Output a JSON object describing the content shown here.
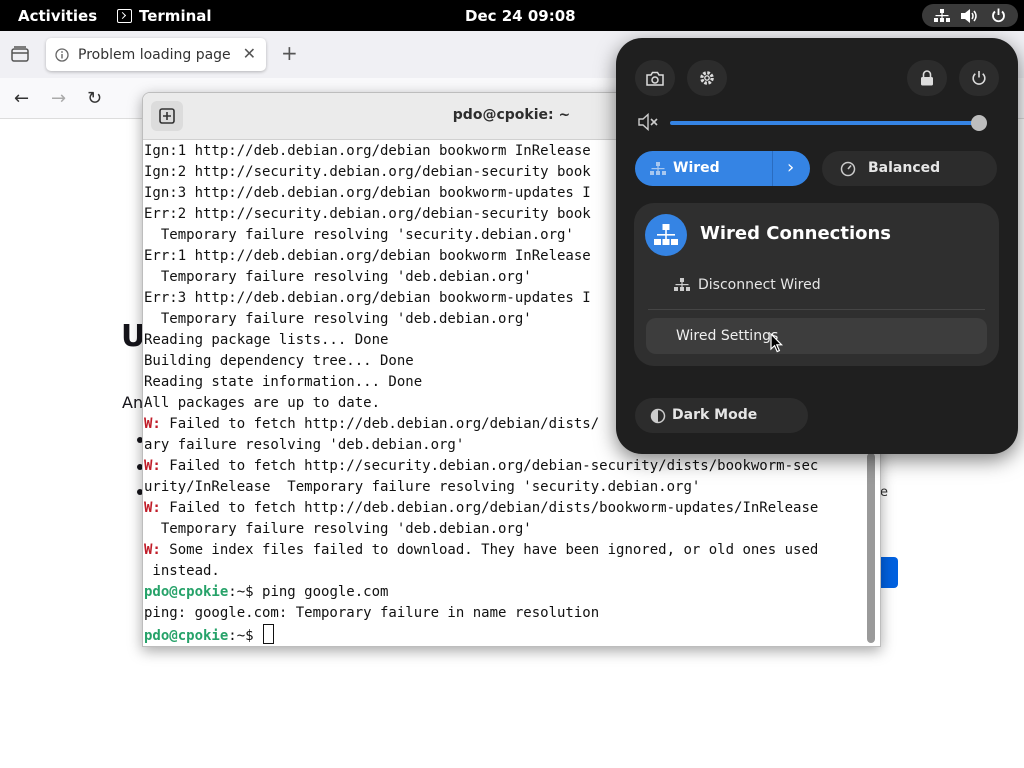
{
  "topbar": {
    "activities": "Activities",
    "app_name": "Terminal",
    "clock": "Dec 24  09:08",
    "status_icons": [
      "network-wired-icon",
      "volume-icon",
      "power-icon"
    ]
  },
  "browser": {
    "tab_title": "Problem loading page",
    "tab_close": "✕",
    "new_tab": "+",
    "nav": {
      "back": "←",
      "forward": "→",
      "reload": "↻"
    },
    "page_heading_fragment": "U",
    "page_text_fragment": "An",
    "page_right_fragment": "e"
  },
  "terminal": {
    "title": "pdo@cpokie: ~",
    "lines": [
      {
        "t": "Ign:1 http://deb.debian.org/debian bookworm InRelease"
      },
      {
        "t": "Ign:2 http://security.debian.org/debian-security book"
      },
      {
        "t": "Ign:3 http://deb.debian.org/debian bookworm-updates I"
      },
      {
        "t": "Err:2 http://security.debian.org/debian-security book"
      },
      {
        "t": "  Temporary failure resolving 'security.debian.org'"
      },
      {
        "t": "Err:1 http://deb.debian.org/debian bookworm InRelease"
      },
      {
        "t": "  Temporary failure resolving 'deb.debian.org'"
      },
      {
        "t": "Err:3 http://deb.debian.org/debian bookworm-updates I"
      },
      {
        "t": "  Temporary failure resolving 'deb.debian.org'"
      },
      {
        "t": "Reading package lists... Done"
      },
      {
        "t": "Building dependency tree... Done"
      },
      {
        "t": "Reading state information... Done"
      },
      {
        "t": "All packages are up to date."
      },
      {
        "w": "W:",
        "t": " Failed to fetch http://deb.debian.org/debian/dists/"
      },
      {
        "t": "ary failure resolving 'deb.debian.org'"
      },
      {
        "w": "W:",
        "t": " Failed to fetch http://security.debian.org/debian-security/dists/bookworm-sec"
      },
      {
        "t": "urity/InRelease  Temporary failure resolving 'security.debian.org'"
      },
      {
        "w": "W:",
        "t": " Failed to fetch http://deb.debian.org/debian/dists/bookworm-updates/InRelease"
      },
      {
        "t": "  Temporary failure resolving 'deb.debian.org'"
      },
      {
        "w": "W:",
        "t": " Some index files failed to download. They have been ignored, or old ones used"
      },
      {
        "t": " instead."
      },
      {
        "p": "pdo@cpokie",
        "t": ":~$ ping google.com"
      },
      {
        "t": "ping: google.com: Temporary failure in name resolution"
      },
      {
        "p": "pdo@cpokie",
        "t": ":~$ ",
        "cursor": true
      }
    ]
  },
  "quick_settings": {
    "volume_level": 0.98,
    "wired_label": "Wired",
    "wired_arrow": "›",
    "power_profile_label": "Balanced",
    "submenu": {
      "title": "Wired Connections",
      "items": [
        "Disconnect Wired",
        "Wired Settings"
      ]
    },
    "dark_mode_label": "Dark Mode",
    "accent_color": "#3584e4"
  }
}
